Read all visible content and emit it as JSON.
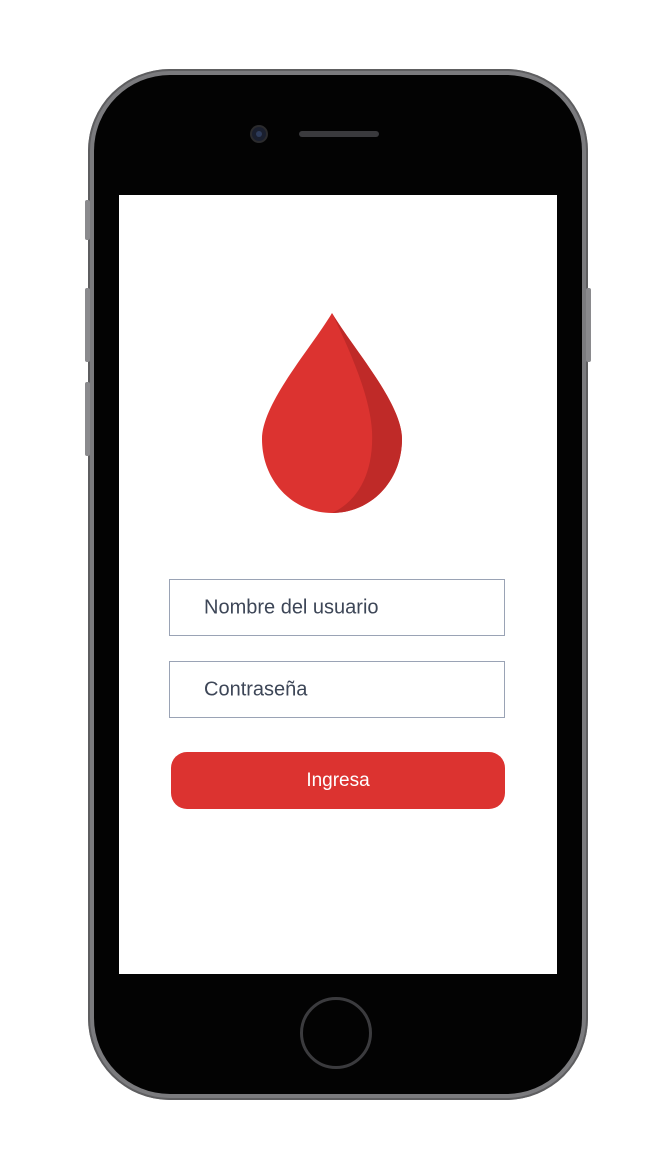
{
  "login": {
    "username_placeholder": "Nombre del usuario",
    "password_placeholder": "Contraseña",
    "submit_label": "Ingresa"
  },
  "colors": {
    "brand_red": "#dc3330",
    "drop_shadow_red": "#bf2a28",
    "field_border": "#9aa3b5",
    "field_text": "#3d4657",
    "phone_body": "#030303"
  },
  "icons": {
    "logo": "blood-drop-icon"
  }
}
